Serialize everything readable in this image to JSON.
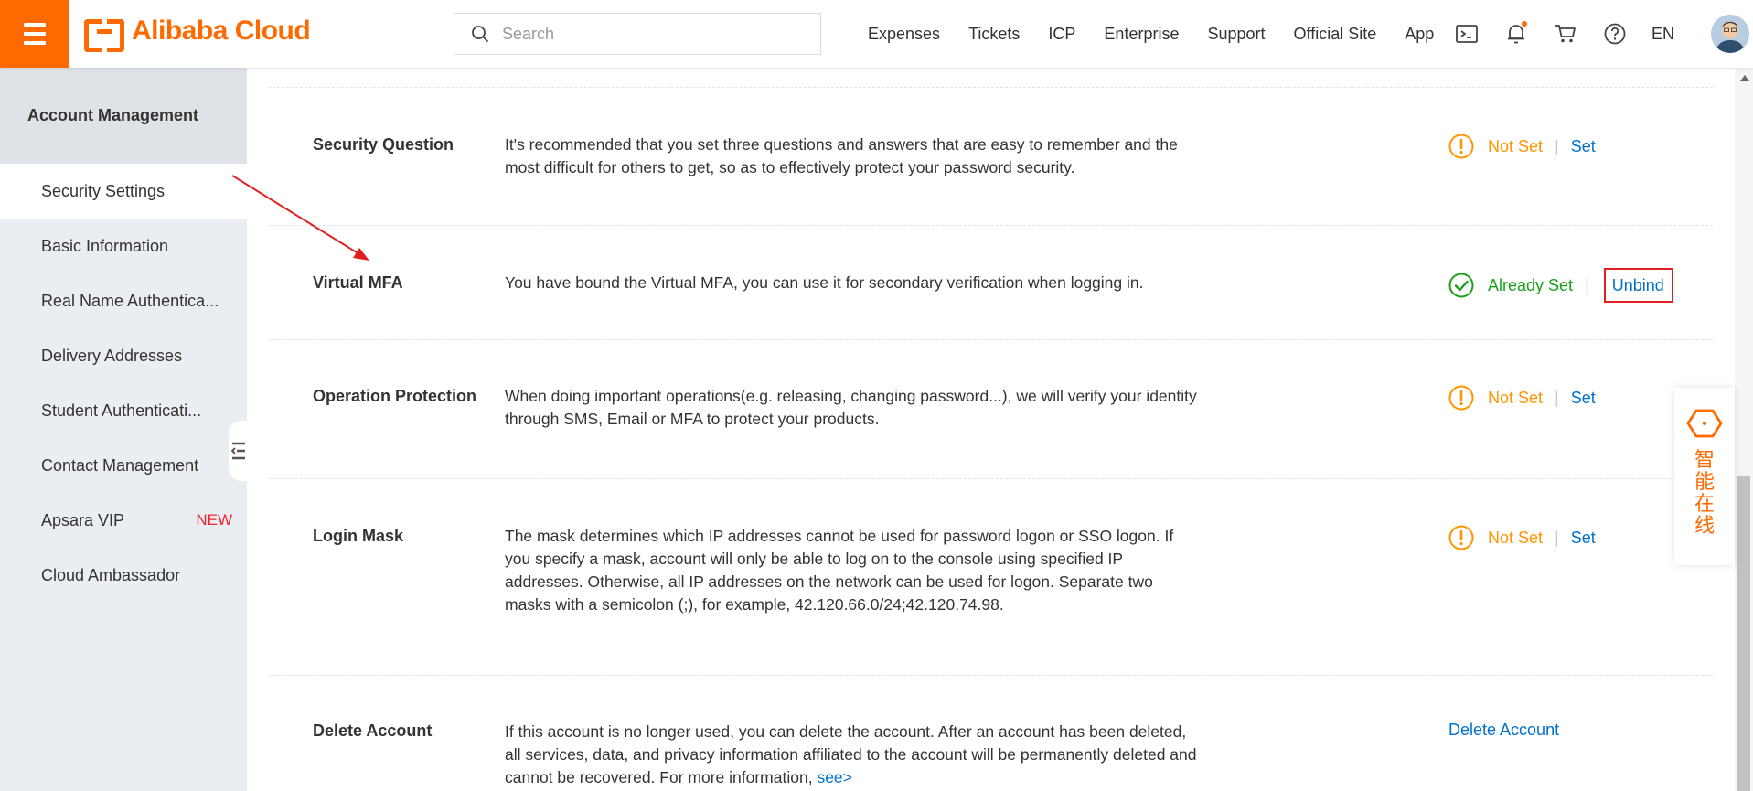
{
  "header": {
    "brand": "Alibaba Cloud",
    "search_placeholder": "Search",
    "nav": [
      "Expenses",
      "Tickets",
      "ICP",
      "Enterprise",
      "Support",
      "Official Site",
      "App"
    ],
    "lang": "EN",
    "icons": [
      "terminal-icon",
      "bell-icon",
      "cart-icon",
      "help-icon"
    ]
  },
  "sidebar": {
    "title": "Account Management",
    "items": [
      {
        "label": "Security Settings",
        "active": true
      },
      {
        "label": "Basic Information"
      },
      {
        "label": "Real Name Authentica..."
      },
      {
        "label": "Delivery Addresses"
      },
      {
        "label": "Student Authenticati..."
      },
      {
        "label": "Contact Management"
      },
      {
        "label": "Apsara VIP",
        "badge": "NEW"
      },
      {
        "label": "Cloud Ambassador"
      }
    ]
  },
  "rows": [
    {
      "title": "Security Question",
      "desc": "It's recommended that you set three questions and answers that are easy to remember and the most difficult for others to get, so as to effectively protect your password security.",
      "status": "Not Set",
      "action": "Set"
    },
    {
      "title": "Virtual MFA",
      "desc": "You have bound the Virtual MFA, you can use it for secondary verification when logging in.",
      "status": "Already Set",
      "action": "Unbind"
    },
    {
      "title": "Operation Protection",
      "desc": "When doing important operations(e.g. releasing, changing password...), we will verify your identity through SMS, Email or MFA to protect your products.",
      "status": "Not Set",
      "action": "Set"
    },
    {
      "title": "Login Mask",
      "desc": "The mask determines which IP addresses cannot be used for password logon or SSO logon. If you specify a mask, account will only be able to log on to the console using specified IP addresses. Otherwise, all IP addresses on the network can be used for logon. Separate two masks with a semicolon (;), for example, 42.120.66.0/24;42.120.74.98.",
      "status": "Not Set",
      "action": "Set"
    },
    {
      "title": "Delete Account",
      "desc": "If this account is no longer used, you can delete the account. After an account has been deleted, all services, data, and privacy information affiliated to the account will be permanently deleted and cannot be recovered. For more information,",
      "desc_link": "see>",
      "action": "Delete Account"
    }
  ],
  "assistant": {
    "label": "智能在线"
  },
  "colors": {
    "brand": "#ff6a00",
    "warning": "#ff9500",
    "success": "#1aa01a",
    "link": "#0070cc",
    "highlight": "#e02020"
  }
}
